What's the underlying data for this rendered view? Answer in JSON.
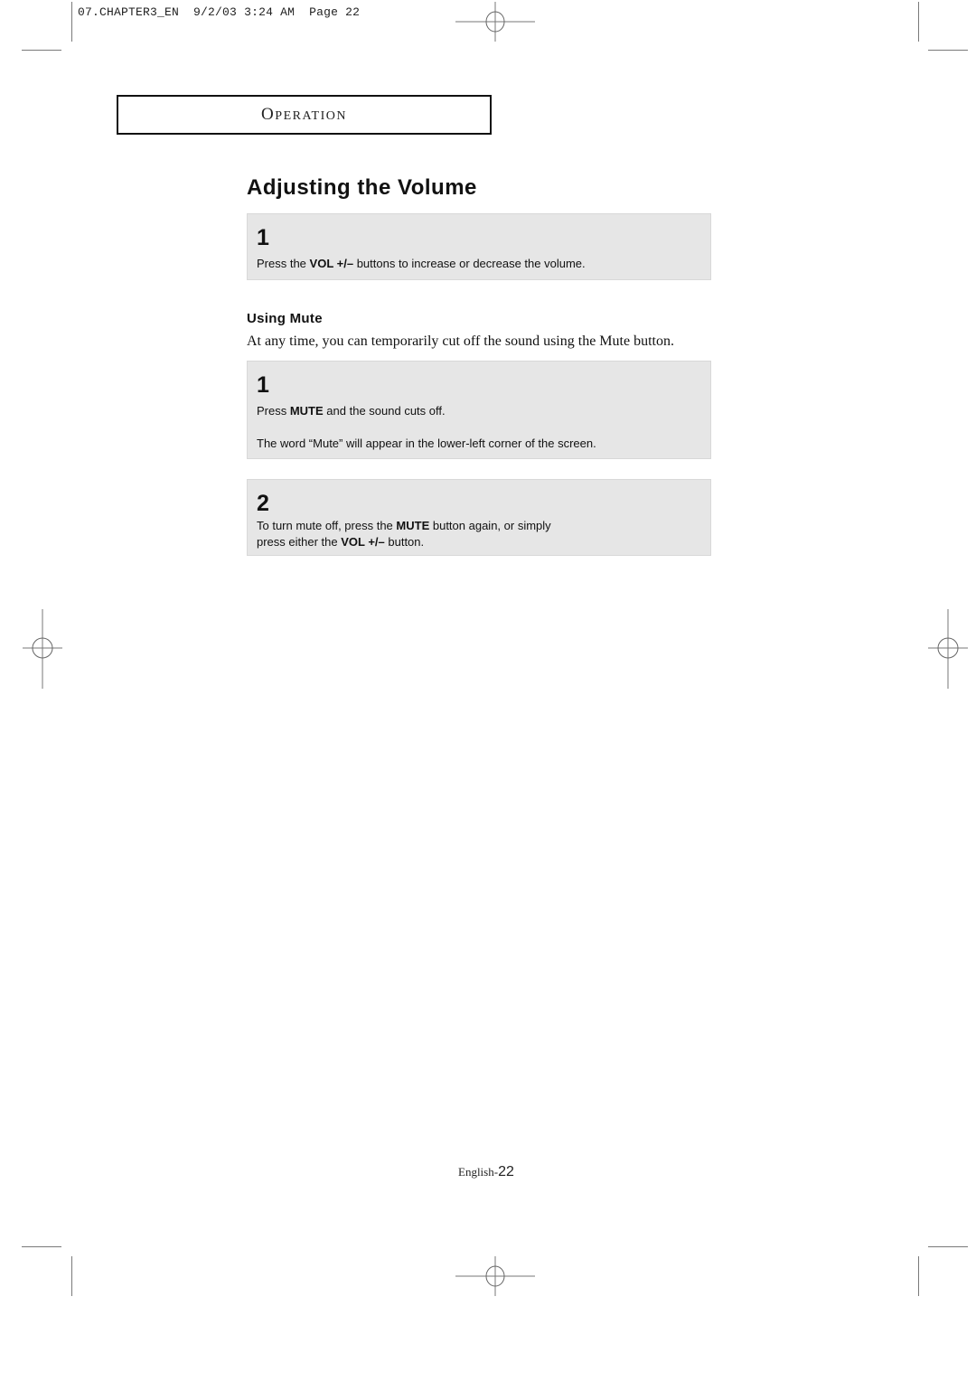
{
  "slug": {
    "file": "07.CHAPTER3_EN",
    "date": "9/2/03",
    "time": "3:24 AM",
    "page_label": "Page",
    "page_number": "22"
  },
  "section": {
    "label_first": "O",
    "label_rest": "PERATION"
  },
  "title": "Adjusting the Volume",
  "steps_volume": [
    {
      "number": "1",
      "text_parts": [
        "Press the ",
        "VOL +/–",
        " buttons to increase or decrease the volume."
      ]
    }
  ],
  "mute": {
    "heading": "Using Mute",
    "intro": "At any time, you can temporarily cut off the sound using the Mute button.",
    "steps": [
      {
        "number": "1",
        "line1_parts": [
          "Press ",
          "MUTE",
          " and the sound cuts off."
        ],
        "line2": "The word “Mute” will appear in the lower-left corner of the screen."
      },
      {
        "number": "2",
        "line1_parts": [
          "To turn mute off, press the ",
          "MUTE",
          " button again, or simply"
        ],
        "line2_parts": [
          "press either the ",
          "VOL +/–",
          " button."
        ]
      }
    ]
  },
  "footer": {
    "language": "English-",
    "page_number": "22"
  }
}
